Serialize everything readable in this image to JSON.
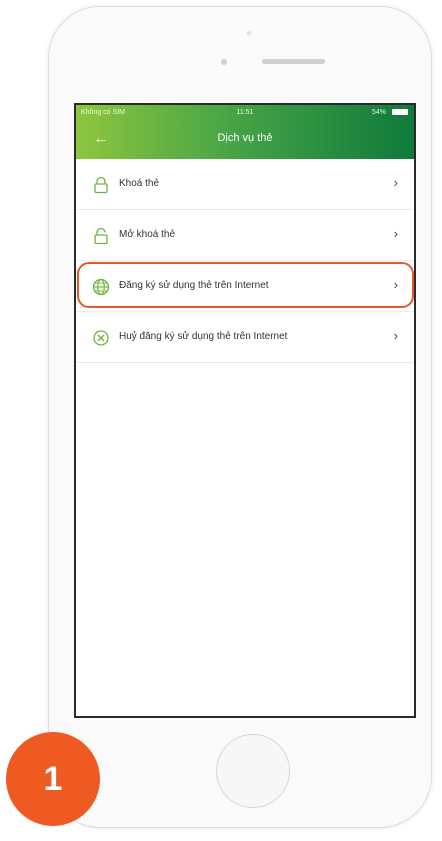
{
  "status_bar": {
    "carrier": "Không có SIM",
    "time": "11:51",
    "battery": "54%"
  },
  "header": {
    "title": "Dịch vụ thẻ",
    "back_icon": "arrow-left-icon"
  },
  "menu": {
    "items": [
      {
        "label": "Khoá thẻ",
        "icon": "lock-closed-icon"
      },
      {
        "label": "Mở khoá thẻ",
        "icon": "lock-open-icon"
      },
      {
        "label": "Đăng ký sử dụng thẻ trên Internet",
        "icon": "globe-icon",
        "highlighted": true
      },
      {
        "label": "Huỷ đăng ký sử dụng thẻ trên Internet",
        "icon": "cancel-circle-icon"
      }
    ]
  },
  "step_badge": {
    "number": "1"
  },
  "colors": {
    "brand_green_light": "#8dc63f",
    "brand_green_dark": "#0f7a3b",
    "highlight_orange": "#e35a2a",
    "badge_orange": "#ee5a21"
  }
}
